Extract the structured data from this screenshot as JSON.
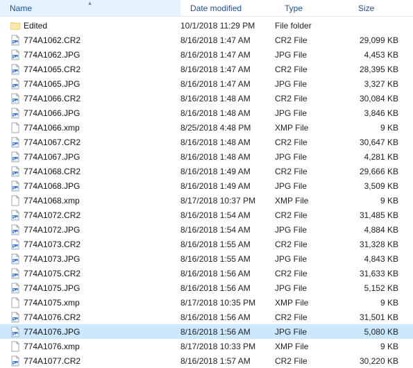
{
  "columns": {
    "name": "Name",
    "date": "Date modified",
    "type": "Type",
    "size": "Size",
    "sort": "name-asc"
  },
  "items": [
    {
      "icon": "folder",
      "name": "Edited",
      "date": "10/1/2018 11:29 PM",
      "type": "File folder",
      "size": "",
      "selected": false
    },
    {
      "icon": "image",
      "name": "774A1062.CR2",
      "date": "8/16/2018 1:47 AM",
      "type": "CR2 File",
      "size": "29,099 KB",
      "selected": false
    },
    {
      "icon": "image",
      "name": "774A1062.JPG",
      "date": "8/16/2018 1:47 AM",
      "type": "JPG File",
      "size": "4,453 KB",
      "selected": false
    },
    {
      "icon": "image",
      "name": "774A1065.CR2",
      "date": "8/16/2018 1:47 AM",
      "type": "CR2 File",
      "size": "28,395 KB",
      "selected": false
    },
    {
      "icon": "image",
      "name": "774A1065.JPG",
      "date": "8/16/2018 1:47 AM",
      "type": "JPG File",
      "size": "3,327 KB",
      "selected": false
    },
    {
      "icon": "image",
      "name": "774A1066.CR2",
      "date": "8/16/2018 1:48 AM",
      "type": "CR2 File",
      "size": "30,084 KB",
      "selected": false
    },
    {
      "icon": "image",
      "name": "774A1066.JPG",
      "date": "8/16/2018 1:48 AM",
      "type": "JPG File",
      "size": "3,846 KB",
      "selected": false
    },
    {
      "icon": "file",
      "name": "774A1066.xmp",
      "date": "8/25/2018 4:48 PM",
      "type": "XMP File",
      "size": "9 KB",
      "selected": false
    },
    {
      "icon": "image",
      "name": "774A1067.CR2",
      "date": "8/16/2018 1:48 AM",
      "type": "CR2 File",
      "size": "30,647 KB",
      "selected": false
    },
    {
      "icon": "image",
      "name": "774A1067.JPG",
      "date": "8/16/2018 1:48 AM",
      "type": "JPG File",
      "size": "4,281 KB",
      "selected": false
    },
    {
      "icon": "image",
      "name": "774A1068.CR2",
      "date": "8/16/2018 1:49 AM",
      "type": "CR2 File",
      "size": "29,666 KB",
      "selected": false
    },
    {
      "icon": "image",
      "name": "774A1068.JPG",
      "date": "8/16/2018 1:49 AM",
      "type": "JPG File",
      "size": "3,509 KB",
      "selected": false
    },
    {
      "icon": "file",
      "name": "774A1068.xmp",
      "date": "8/17/2018 10:37 PM",
      "type": "XMP File",
      "size": "9 KB",
      "selected": false
    },
    {
      "icon": "image",
      "name": "774A1072.CR2",
      "date": "8/16/2018 1:54 AM",
      "type": "CR2 File",
      "size": "31,485 KB",
      "selected": false
    },
    {
      "icon": "image",
      "name": "774A1072.JPG",
      "date": "8/16/2018 1:54 AM",
      "type": "JPG File",
      "size": "4,884 KB",
      "selected": false
    },
    {
      "icon": "image",
      "name": "774A1073.CR2",
      "date": "8/16/2018 1:55 AM",
      "type": "CR2 File",
      "size": "31,328 KB",
      "selected": false
    },
    {
      "icon": "image",
      "name": "774A1073.JPG",
      "date": "8/16/2018 1:55 AM",
      "type": "JPG File",
      "size": "4,843 KB",
      "selected": false
    },
    {
      "icon": "image",
      "name": "774A1075.CR2",
      "date": "8/16/2018 1:56 AM",
      "type": "CR2 File",
      "size": "31,633 KB",
      "selected": false
    },
    {
      "icon": "image",
      "name": "774A1075.JPG",
      "date": "8/16/2018 1:56 AM",
      "type": "JPG File",
      "size": "5,152 KB",
      "selected": false
    },
    {
      "icon": "file",
      "name": "774A1075.xmp",
      "date": "8/17/2018 10:35 PM",
      "type": "XMP File",
      "size": "9 KB",
      "selected": false
    },
    {
      "icon": "image",
      "name": "774A1076.CR2",
      "date": "8/16/2018 1:56 AM",
      "type": "CR2 File",
      "size": "31,501 KB",
      "selected": false
    },
    {
      "icon": "image",
      "name": "774A1076.JPG",
      "date": "8/16/2018 1:56 AM",
      "type": "JPG File",
      "size": "5,080 KB",
      "selected": true
    },
    {
      "icon": "file",
      "name": "774A1076.xmp",
      "date": "8/17/2018 10:33 PM",
      "type": "XMP File",
      "size": "9 KB",
      "selected": false
    },
    {
      "icon": "image",
      "name": "774A1077.CR2",
      "date": "8/16/2018 1:57 AM",
      "type": "CR2 File",
      "size": "30,220 KB",
      "selected": false
    }
  ]
}
